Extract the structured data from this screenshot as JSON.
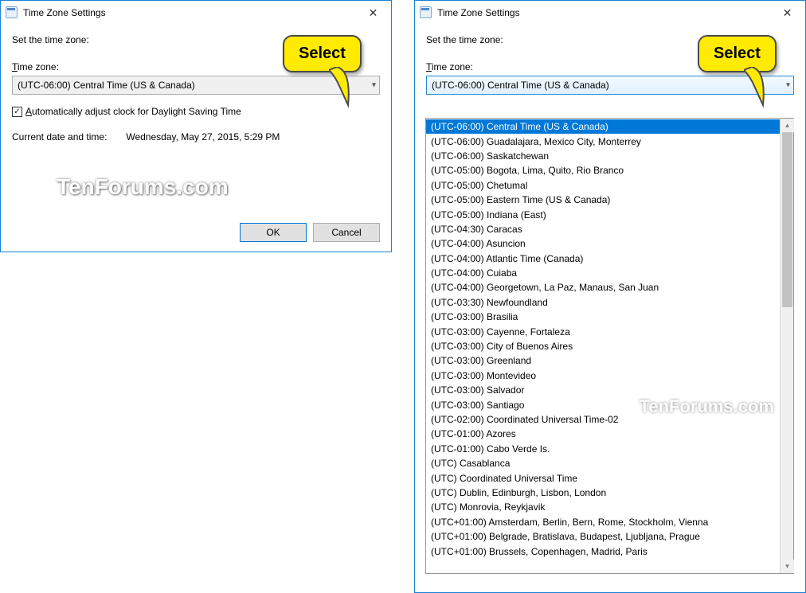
{
  "window": {
    "title": "Time Zone Settings",
    "close_glyph": "✕"
  },
  "instruction": "Set the time zone:",
  "tz_label_prefix": "T",
  "tz_label_rest": "ime zone:",
  "selected_timezone": "(UTC-06:00) Central Time (US & Canada)",
  "checkbox_prefix": "A",
  "checkbox_rest": "utomatically adjust clock for Daylight Saving Time",
  "checkbox_checked": true,
  "current_label": "Current date and time:",
  "current_value": "Wednesday, May 27, 2015, 5:29 PM",
  "buttons": {
    "ok": "OK",
    "cancel": "Cancel"
  },
  "callout_text": "Select",
  "watermark": "TenForums.com",
  "dropdown_selected_index": 0,
  "dropdown_options": [
    "(UTC-06:00) Central Time (US & Canada)",
    "(UTC-06:00) Guadalajara, Mexico City, Monterrey",
    "(UTC-06:00) Saskatchewan",
    "(UTC-05:00) Bogota, Lima, Quito, Rio Branco",
    "(UTC-05:00) Chetumal",
    "(UTC-05:00) Eastern Time (US & Canada)",
    "(UTC-05:00) Indiana (East)",
    "(UTC-04:30) Caracas",
    "(UTC-04:00) Asuncion",
    "(UTC-04:00) Atlantic Time (Canada)",
    "(UTC-04:00) Cuiaba",
    "(UTC-04:00) Georgetown, La Paz, Manaus, San Juan",
    "(UTC-03:30) Newfoundland",
    "(UTC-03:00) Brasilia",
    "(UTC-03:00) Cayenne, Fortaleza",
    "(UTC-03:00) City of Buenos Aires",
    "(UTC-03:00) Greenland",
    "(UTC-03:00) Montevideo",
    "(UTC-03:00) Salvador",
    "(UTC-03:00) Santiago",
    "(UTC-02:00) Coordinated Universal Time-02",
    "(UTC-01:00) Azores",
    "(UTC-01:00) Cabo Verde Is.",
    "(UTC) Casablanca",
    "(UTC) Coordinated Universal Time",
    "(UTC) Dublin, Edinburgh, Lisbon, London",
    "(UTC) Monrovia, Reykjavik",
    "(UTC+01:00) Amsterdam, Berlin, Bern, Rome, Stockholm, Vienna",
    "(UTC+01:00) Belgrade, Bratislava, Budapest, Ljubljana, Prague",
    "(UTC+01:00) Brussels, Copenhagen, Madrid, Paris"
  ]
}
